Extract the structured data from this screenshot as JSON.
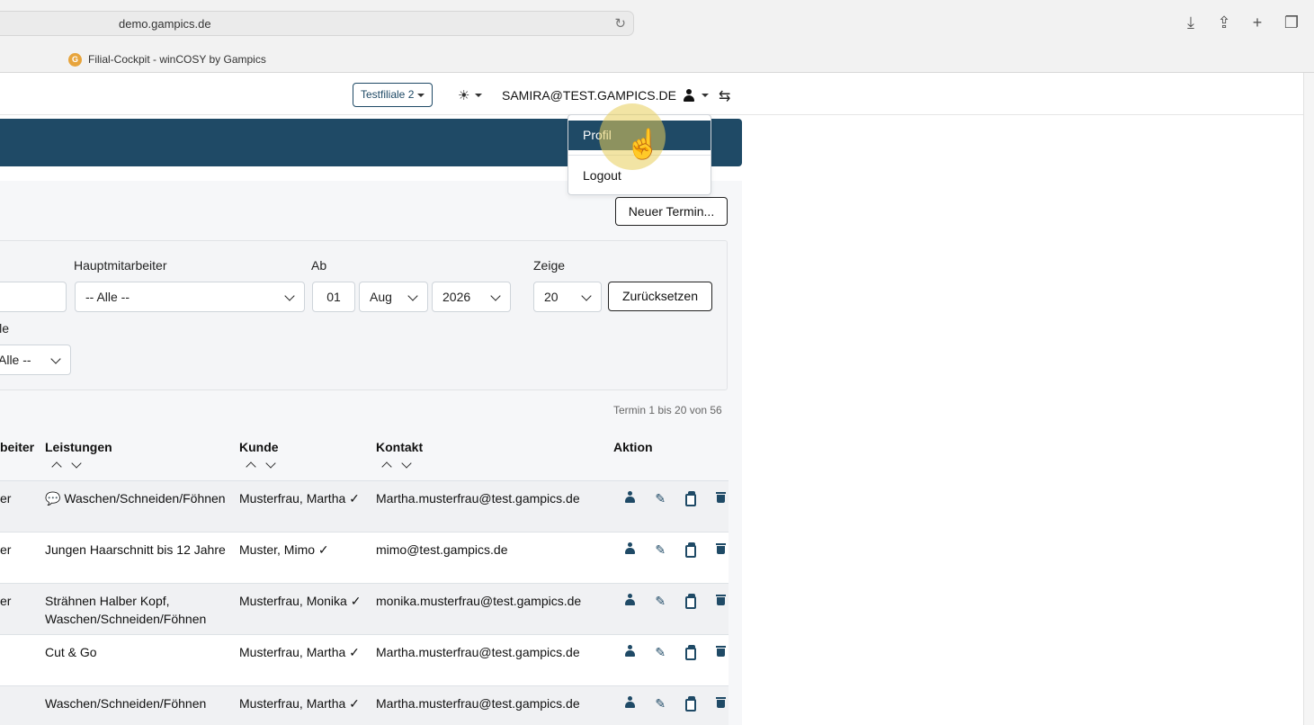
{
  "browser": {
    "url": "demo.gampics.de",
    "tab_title": "Filial-Cockpit - winCOSY by Gampics",
    "favicon_text": "G"
  },
  "navbar": {
    "branch": "Testfiliale 2",
    "theme_icon": "☀",
    "user": "SAMIRA@TEST.GAMPICS.DE",
    "switch_icon": "⇆"
  },
  "dropdown": {
    "profile": "Profil",
    "logout": "Logout"
  },
  "toolbar": {
    "new_appointment": "Neuer Termin..."
  },
  "filters": {
    "hauptmitarbeiter_label": "Hauptmitarbeiter",
    "hauptmitarbeiter_value": "-- Alle --",
    "ab_label": "Ab",
    "day": "01",
    "month": "Aug",
    "year": "2026",
    "zeige_label": "Zeige",
    "zeige_value": "20",
    "reset": "Zurücksetzen",
    "partial_label": "lle",
    "partial_select": "Alle --"
  },
  "table": {
    "count_text": "Termin 1 bis 20 von 56",
    "headers": {
      "mitarbeiter": "beiter",
      "leistungen": "Leistungen",
      "kunde": "Kunde",
      "kontakt": "Kontakt",
      "aktion": "Aktion"
    },
    "rows": [
      {
        "emp": "er",
        "service": "💬 Waschen/Schneiden/Föhnen",
        "kunde": "Musterfrau, Martha ✓",
        "kontakt": "Martha.musterfrau@test.gampics.de"
      },
      {
        "emp": "er",
        "service": "Jungen Haarschnitt bis 12 Jahre",
        "kunde": "Muster, Mimo ✓",
        "kontakt": "mimo@test.gampics.de"
      },
      {
        "emp": "er",
        "service": "Strähnen Halber Kopf, Waschen/Schneiden/Föhnen",
        "kunde": "Musterfrau, Monika ✓",
        "kontakt": "monika.musterfrau@test.gampics.de"
      },
      {
        "emp": "",
        "service": "Cut & Go",
        "kunde": "Musterfrau, Martha ✓",
        "kontakt": "Martha.musterfrau@test.gampics.de"
      },
      {
        "emp": "",
        "service": "Waschen/Schneiden/Föhnen",
        "kunde": "Musterfrau, Martha ✓",
        "kontakt": "Martha.musterfrau@test.gampics.de"
      }
    ],
    "edit_icon": "✎"
  },
  "colors": {
    "primary": "#1f4a66",
    "highlight": "#e8cd5a"
  }
}
